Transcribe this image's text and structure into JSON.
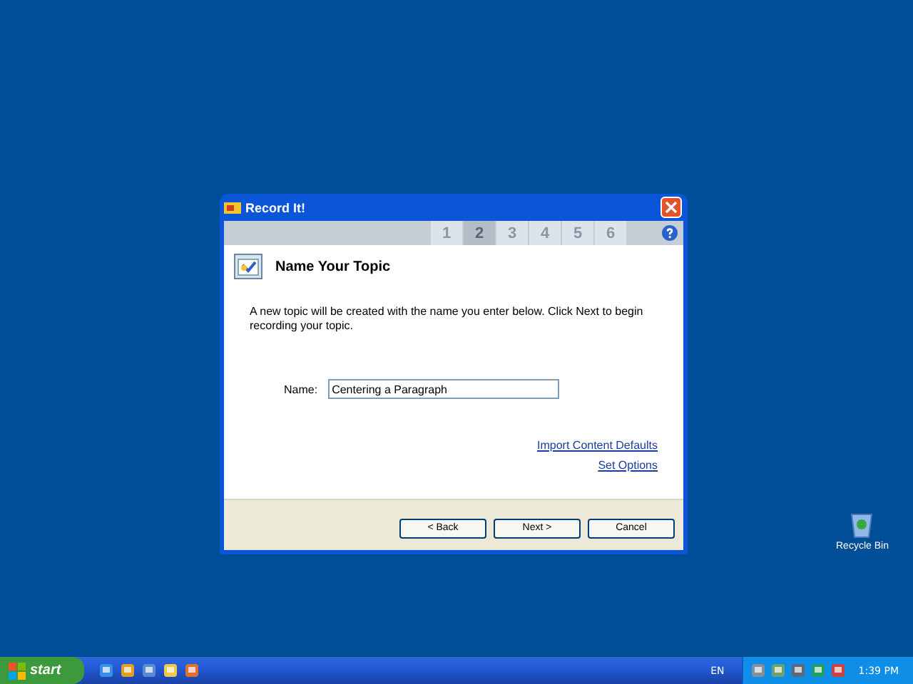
{
  "window": {
    "title": "Record It!"
  },
  "steps": [
    {
      "label": "1",
      "selected": false
    },
    {
      "label": "2",
      "selected": true
    },
    {
      "label": "3",
      "selected": false
    },
    {
      "label": "4",
      "selected": false
    },
    {
      "label": "5",
      "selected": false
    },
    {
      "label": "6",
      "selected": false
    }
  ],
  "heading": "Name Your Topic",
  "description": "A new topic will be created with the name you enter below. Click Next to begin recording your topic.",
  "name_field": {
    "label": "Name:",
    "value": "Centering a Paragraph"
  },
  "links": [
    "Import Content Defaults",
    "Set Options"
  ],
  "buttons": [
    "< Back",
    "Next >",
    "Cancel"
  ],
  "desktop_icons": [
    {
      "label": "Recycle Bin"
    }
  ],
  "taskbar": {
    "start": "start",
    "language": "EN",
    "clock": "1:39 PM"
  }
}
